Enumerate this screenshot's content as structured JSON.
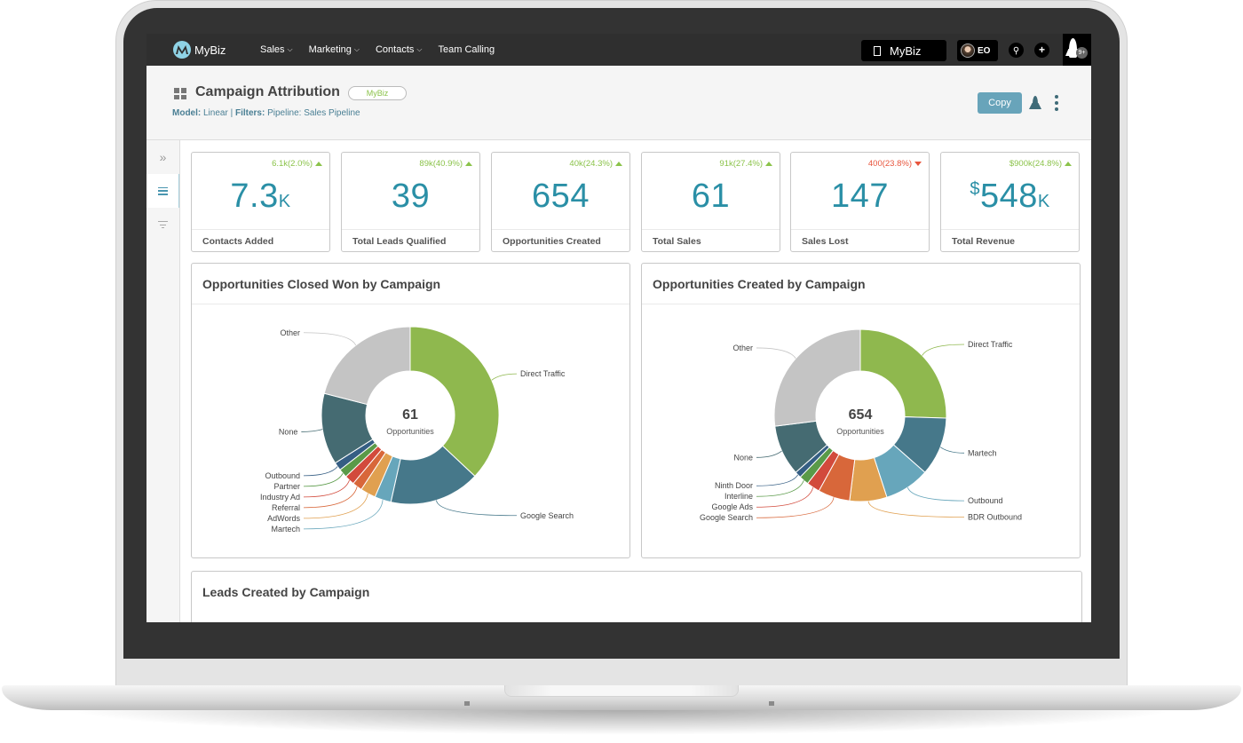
{
  "nav": {
    "logo_text": "MyBiz",
    "items": [
      {
        "label": "Sales",
        "has_dropdown": true
      },
      {
        "label": "Marketing",
        "has_dropdown": true
      },
      {
        "label": "Contacts",
        "has_dropdown": true
      },
      {
        "label": "Team Calling",
        "has_dropdown": false
      }
    ],
    "org_switcher": "MyBiz",
    "user_initials": "EO",
    "search_icon": "search-icon",
    "add_icon": "plus-icon",
    "notifications_badge": "9+"
  },
  "header": {
    "title": "Campaign Attribution",
    "org_pill": "MyBiz",
    "model_label": "Model:",
    "model_value": "Linear",
    "filters_label": "Filters:",
    "filters_value": "Pipeline: Sales Pipeline",
    "copy_label": "Copy"
  },
  "sidebar": {
    "items": [
      {
        "icon": "chevrons-right-icon",
        "glyph": "»"
      },
      {
        "icon": "list-icon",
        "active": true
      },
      {
        "icon": "filter-icon"
      }
    ]
  },
  "kpis": [
    {
      "label": "Contacts Added",
      "value": "7.3",
      "prefix": "",
      "unit": "K",
      "delta": "6.1k(2.0%)",
      "direction": "up"
    },
    {
      "label": "Total Leads Qualified",
      "value": "39",
      "prefix": "",
      "unit": "",
      "delta": "89k(40.9%)",
      "direction": "up"
    },
    {
      "label": "Opportunities Created",
      "value": "654",
      "prefix": "",
      "unit": "",
      "delta": "40k(24.3%)",
      "direction": "up"
    },
    {
      "label": "Total Sales",
      "value": "61",
      "prefix": "",
      "unit": "",
      "delta": "91k(27.4%)",
      "direction": "up"
    },
    {
      "label": "Sales Lost",
      "value": "147",
      "prefix": "",
      "unit": "",
      "delta": "400(23.8%)",
      "direction": "down"
    },
    {
      "label": "Total Revenue",
      "value": "548",
      "prefix": "$",
      "unit": "K",
      "delta": "$900k(24.8%)",
      "direction": "up"
    }
  ],
  "colors": {
    "accent": "#2a8fa6",
    "positive": "#8bc34a",
    "negative": "#e8553d",
    "button": "#68a4ba"
  },
  "chart_data": [
    {
      "type": "pie",
      "title": "Opportunities Closed Won by Campaign",
      "center_value": "61",
      "center_label": "Opportunities",
      "slices": [
        {
          "label": "Direct Traffic",
          "value": 37.0,
          "color": "#8fb84e"
        },
        {
          "label": "Google Search",
          "value": 16.5,
          "color": "#46788a"
        },
        {
          "label": "Martech",
          "value": 3.0,
          "color": "#67a6bb"
        },
        {
          "label": "AdWords",
          "value": 2.8,
          "color": "#e0a050"
        },
        {
          "label": "Referral",
          "value": 1.8,
          "color": "#d8673a"
        },
        {
          "label": "Industry Ad",
          "value": 1.8,
          "color": "#d24a3c"
        },
        {
          "label": "Partner",
          "value": 1.6,
          "color": "#5a9a48"
        },
        {
          "label": "Outbound",
          "value": 1.5,
          "color": "#355e84"
        },
        {
          "label": "None",
          "value": 13.0,
          "color": "#456b72"
        },
        {
          "label": "Other",
          "value": 21.0,
          "color": "#c4c4c4"
        }
      ]
    },
    {
      "type": "pie",
      "title": "Opportunities Created by Campaign",
      "center_value": "654",
      "center_label": "Opportunities",
      "slices": [
        {
          "label": "Direct Traffic",
          "value": 25.5,
          "color": "#8fb84e"
        },
        {
          "label": "Martech",
          "value": 11.0,
          "color": "#46788a"
        },
        {
          "label": "Outbound",
          "value": 8.5,
          "color": "#67a6bb"
        },
        {
          "label": "BDR Outbound",
          "value": 7.0,
          "color": "#e0a050"
        },
        {
          "label": "Google Search",
          "value": 6.0,
          "color": "#d8673a"
        },
        {
          "label": "Google Ads",
          "value": 2.5,
          "color": "#d24a3c"
        },
        {
          "label": "Interline",
          "value": 1.8,
          "color": "#5a9a48"
        },
        {
          "label": "Ninth Door",
          "value": 1.2,
          "color": "#355e84"
        },
        {
          "label": "None",
          "value": 9.5,
          "color": "#456b72"
        },
        {
          "label": "Other",
          "value": 27.0,
          "color": "#c4c4c4"
        }
      ]
    }
  ],
  "leads_card": {
    "title": "Leads Created by Campaign"
  }
}
